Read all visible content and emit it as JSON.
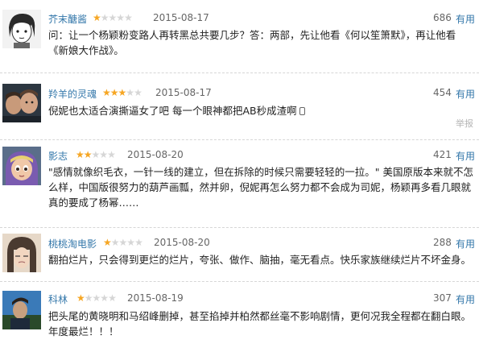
{
  "useful_label": "有用",
  "report_label": "举报",
  "star_full": "★",
  "star_empty": "★",
  "reviews": [
    {
      "user": "芥末醣酱",
      "rating": 1,
      "date": "2015-08-17",
      "votes": "686",
      "text": "问：让一个杨颖粉变路人再转黑总共要几步？答：两部，先让他看《何以笙箫默》，再让他看《新娘大作战》。"
    },
    {
      "user": "羚羊的灵魂",
      "rating": 3,
      "date": "2015-08-17",
      "votes": "454",
      "text": "倪妮也太适合演撕逼女了吧 每一个眼神都把AB秒成渣啊"
    },
    {
      "user": "影志",
      "rating": 2,
      "date": "2015-08-20",
      "votes": "421",
      "text": "\"感情就像织毛衣，一针一线的建立，但在拆除的时候只需要轻轻的一拉。\" 美国原版本来就不怎么样，中国版很努力的葫芦画瓢，然并卵，倪妮再怎么努力都不会成为司妮，杨颖再多看几眼就真的要成了杨幂……"
    },
    {
      "user": "桃桃淘电影",
      "rating": 1,
      "date": "2015-08-20",
      "votes": "288",
      "text": "翻拍烂片，只会得到更烂的烂片，夸张、做作、脑抽，毫无看点。快乐家族继续烂片不坏金身。"
    },
    {
      "user": "科林",
      "rating": 1,
      "date": "2015-08-19",
      "votes": "307",
      "text": "把头尾的黄晓明和马绍峰删掉，甚至掐掉并柏然都丝毫不影响剧情，更何况我全程都在翻白眼。年度最烂！！！"
    }
  ]
}
